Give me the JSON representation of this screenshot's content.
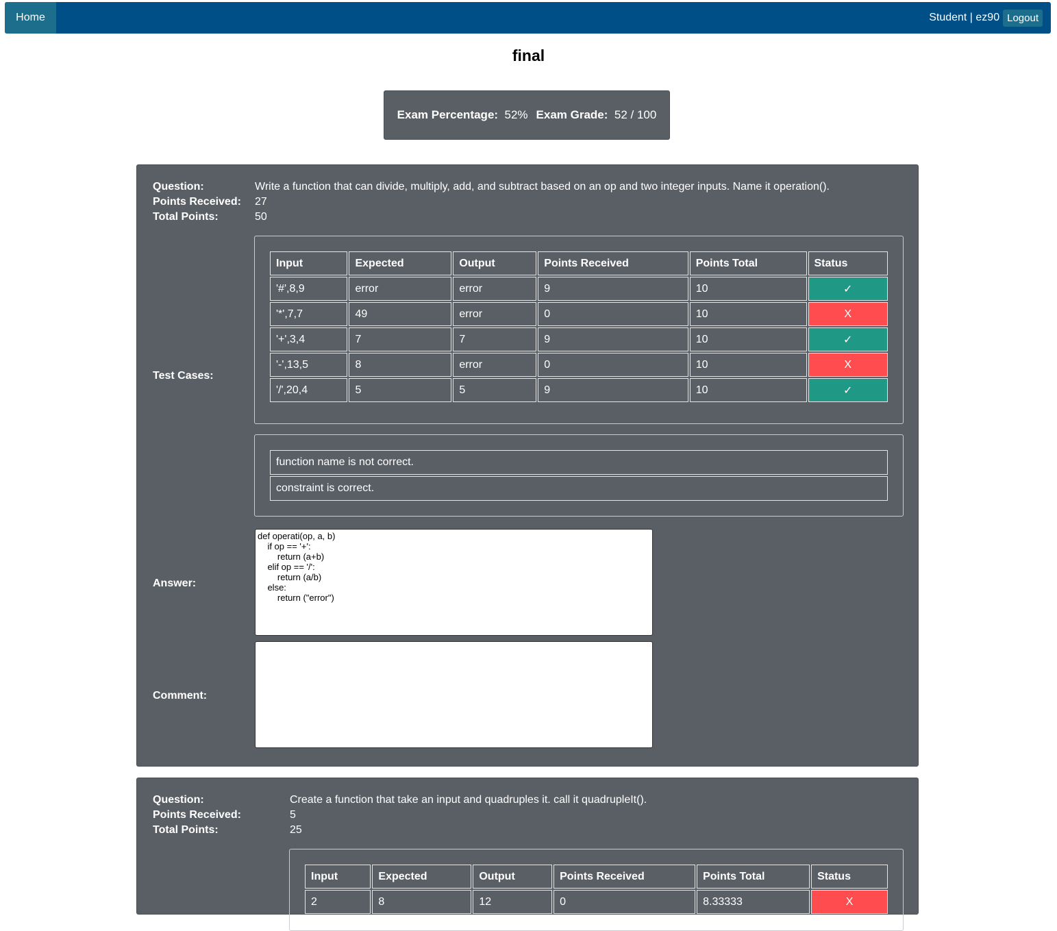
{
  "nav": {
    "home": "Home",
    "user": "Student | ez90",
    "logout": "Logout"
  },
  "page": {
    "title": "final"
  },
  "summary": {
    "pct_label": "Exam Percentage:",
    "pct_value": "52%",
    "grade_label": "Exam Grade:",
    "grade_value": "52 / 100"
  },
  "labels": {
    "question": "Question:",
    "points_received": "Points Received:",
    "total_points": "Total Points:",
    "test_cases": "Test Cases:",
    "answer": "Answer:",
    "comment": "Comment:"
  },
  "headers": [
    "Input",
    "Expected",
    "Output",
    "Points Received",
    "Points Total",
    "Status"
  ],
  "questions": [
    {
      "question": "Write a function that can divide, multiply, add, and subtract based on an op and two integer inputs. Name it operation().",
      "points_received": "27",
      "total_points": "50",
      "rows": [
        [
          "'#',8,9",
          "error",
          "error",
          "9",
          "10",
          "✓"
        ],
        [
          "'*',7,7",
          "49",
          "error",
          "0",
          "10",
          "X"
        ],
        [
          "'+',3,4",
          "7",
          "7",
          "9",
          "10",
          "✓"
        ],
        [
          "'-',13,5",
          "8",
          "error",
          "0",
          "10",
          "X"
        ],
        [
          "'/',20,4",
          "5",
          "5",
          "9",
          "10",
          "✓"
        ]
      ],
      "messages": [
        "function name is not correct.",
        "constraint is correct."
      ],
      "answer": "def operati(op, a, b)\n    if op == '+':\n        return (a+b)\n    elif op == '/':\n        return (a/b)\n    else:\n        return (\"error\")",
      "comment": ""
    },
    {
      "question": "Create a function that take an input and quadruples it. call it quadrupleIt().",
      "points_received": "5",
      "total_points": "25",
      "rows": [
        [
          "2",
          "8",
          "12",
          "0",
          "8.33333",
          "X"
        ]
      ]
    }
  ],
  "colors": {
    "nav": "#004f87",
    "panel": "#5a5f66",
    "pass": "#1f9985",
    "fail": "#ff4d4f"
  }
}
